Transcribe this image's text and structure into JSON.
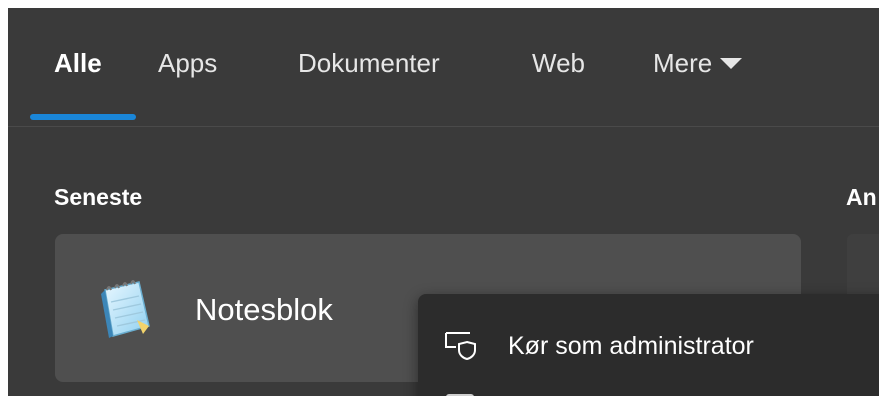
{
  "tabs": [
    {
      "label": "Alle",
      "active": true
    },
    {
      "label": "Apps",
      "active": false
    },
    {
      "label": "Dokumenter",
      "active": false
    },
    {
      "label": "Web",
      "active": false
    },
    {
      "label": "Mere",
      "active": false
    }
  ],
  "accent_color": "#1a86d8",
  "recent": {
    "title": "Seneste",
    "items": [
      {
        "name": "Notesblok",
        "icon": "notepad-icon"
      }
    ]
  },
  "right_section": {
    "heading": "An"
  },
  "context_menu": {
    "items": [
      {
        "label": "Kør som administrator",
        "icon": "admin-shield-icon"
      }
    ]
  }
}
